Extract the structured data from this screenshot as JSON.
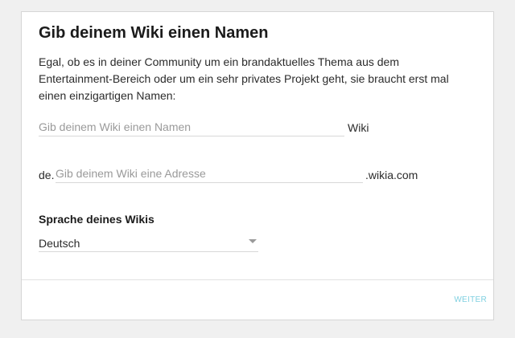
{
  "card": {
    "title": "Gib deinem Wiki einen Namen",
    "intro": "Egal, ob es in deiner Community um ein brandaktuelles Thema aus dem Entertainment-Bereich oder um ein sehr privates Projekt geht, sie braucht erst mal einen einzigartigen Namen:"
  },
  "name_field": {
    "value": "",
    "placeholder": "Gib deinem Wiki einen Namen",
    "suffix": "Wiki"
  },
  "address_field": {
    "prefix": "de.",
    "value": "",
    "placeholder": "Gib deinem Wiki eine Adresse",
    "suffix": ".wikia.com"
  },
  "language": {
    "label": "Sprache deines Wikis",
    "selected": "Deutsch"
  },
  "footer": {
    "next_label": "WEITER"
  },
  "colors": {
    "accent": "#7fd0e0"
  }
}
